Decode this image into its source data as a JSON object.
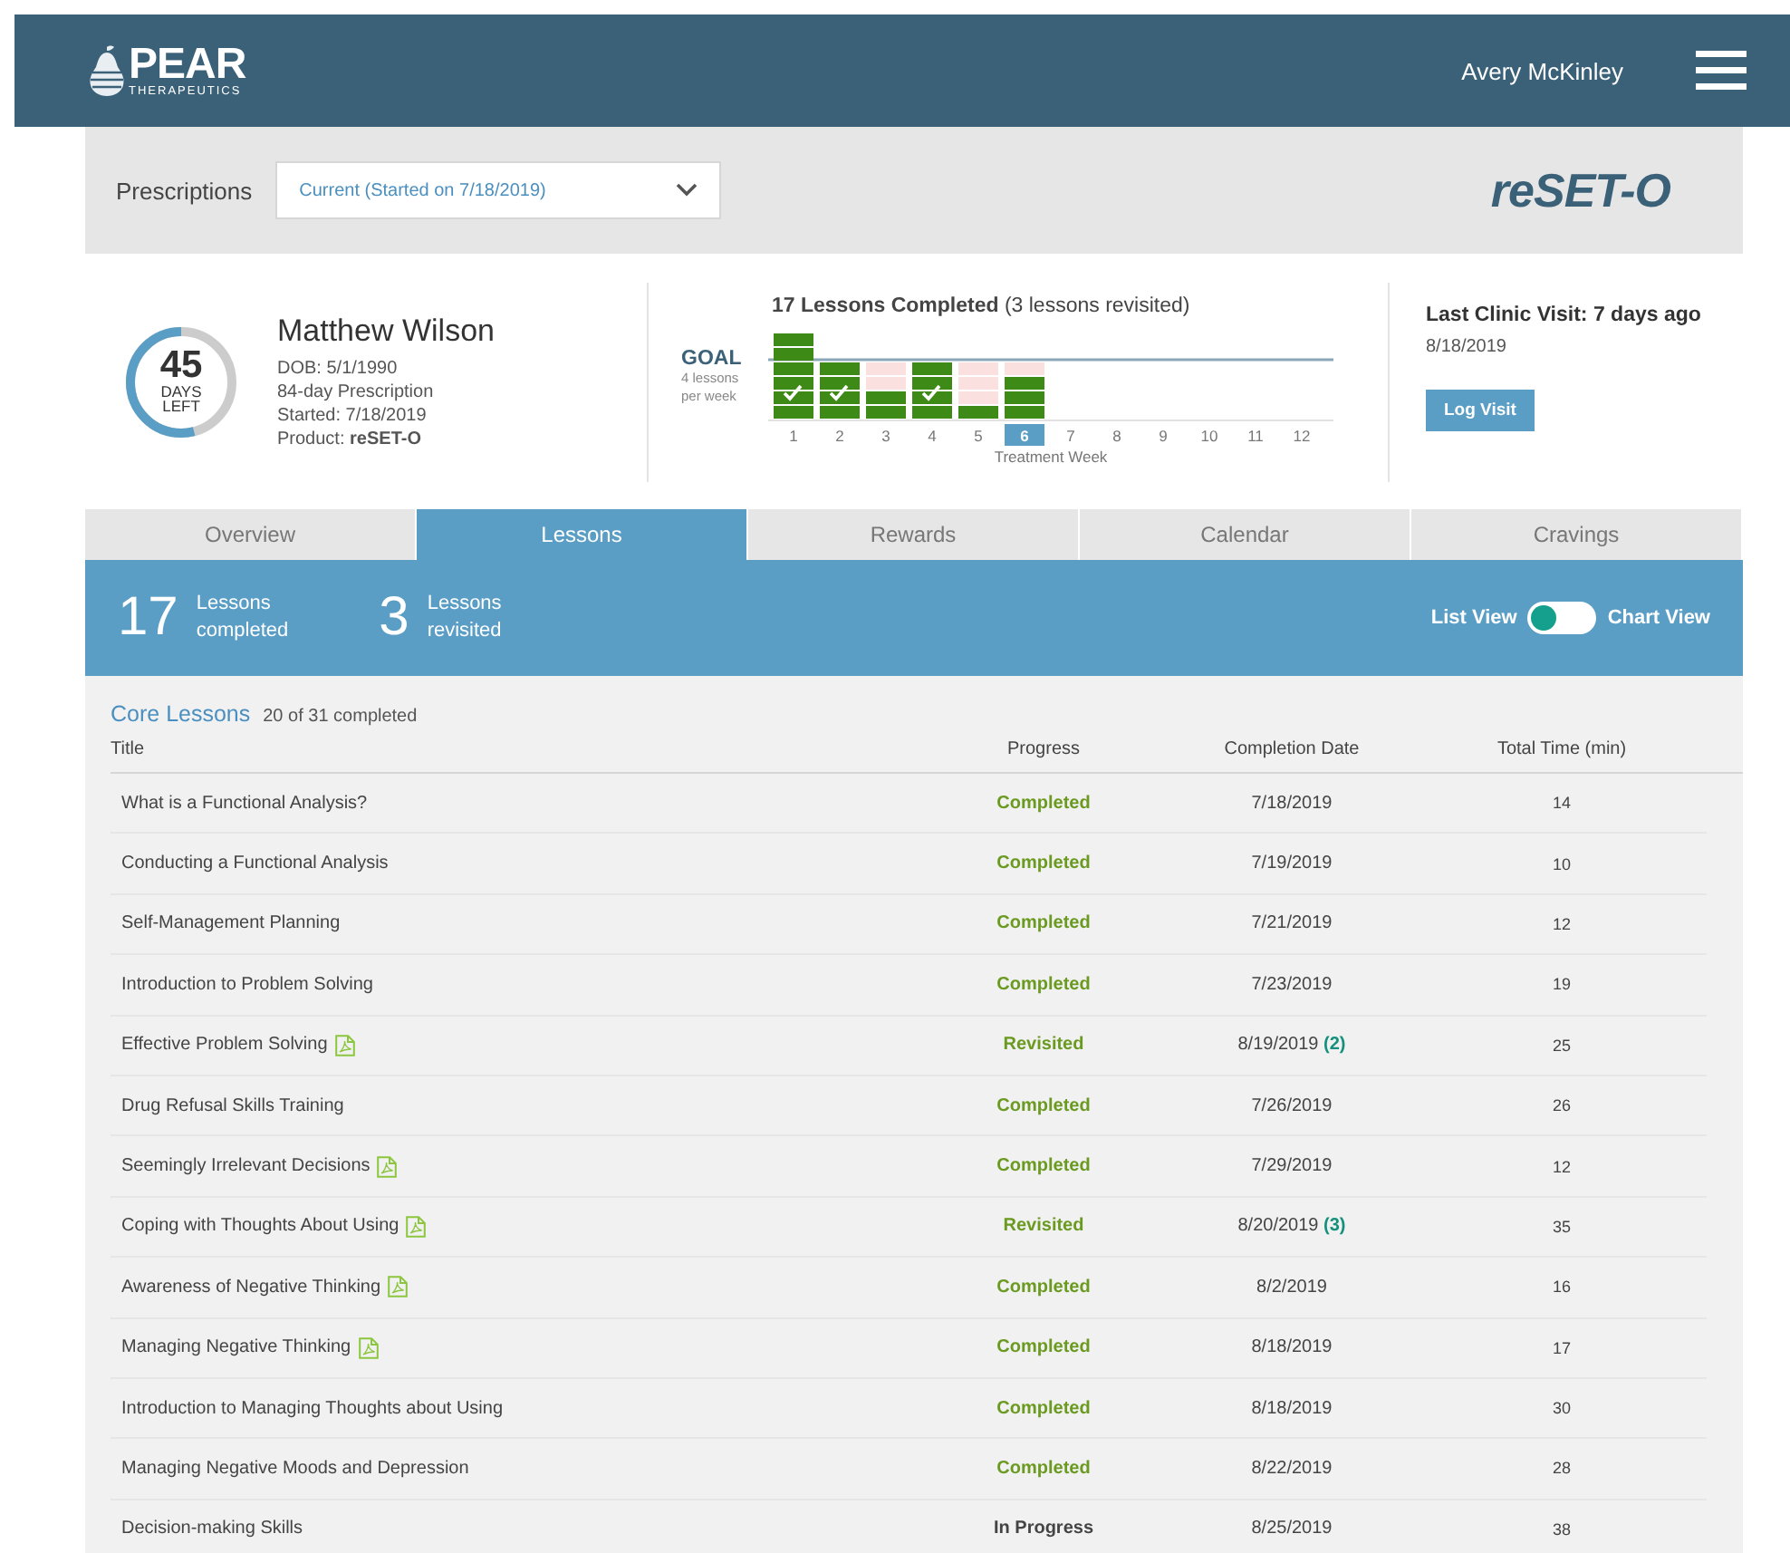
{
  "header": {
    "brand": "PEAR",
    "brand_sub": "THERAPEUTICS",
    "user": "Avery McKinley"
  },
  "prescriptions": {
    "label": "Prescriptions",
    "value": "Current (Started on 7/18/2019)",
    "product_logo": "reSET-O"
  },
  "patient": {
    "days_left": "45",
    "days_caption": "DAYS",
    "left_caption": "LEFT",
    "level": 0.54,
    "name": "Matthew Wilson",
    "details": [
      "DOB: 5/1/1990",
      "84-day Prescription",
      "Started: 7/18/2019",
      "Product: **reSET-O**"
    ]
  },
  "progress": {
    "title": "**17 Lessons Completed**  (3 lessons revisited)",
    "goal_label": "GOAL",
    "goal_note": [
      "4 lessons",
      "per week"
    ],
    "weeks": [
      {
        "label": "1",
        "selected": false
      },
      {
        "label": "2",
        "selected": false
      },
      {
        "label": "3",
        "selected": false
      },
      {
        "label": "4",
        "selected": false
      },
      {
        "label": "5",
        "selected": false
      },
      {
        "label": "6",
        "selected": true
      },
      {
        "label": "7",
        "selected": false
      },
      {
        "label": "8",
        "selected": false
      },
      {
        "label": "9",
        "selected": false
      },
      {
        "label": "10",
        "selected": false
      },
      {
        "label": "11",
        "selected": false
      },
      {
        "label": "12",
        "selected": false
      }
    ],
    "xlabel": "Treatment Week"
  },
  "clinic": {
    "title": "Last Clinic Visit: 7 days ago",
    "date": "8/18/2019",
    "button": "Log Visit"
  },
  "tabs": [
    {
      "label": "Overview",
      "selected": false
    },
    {
      "label": "Lessons",
      "selected": true
    },
    {
      "label": "Rewards",
      "selected": false
    },
    {
      "label": "Calendar",
      "selected": false
    },
    {
      "label": "Cravings",
      "selected": false
    }
  ],
  "summary": {
    "stats": [
      {
        "number": "17",
        "label": [
          "Lessons",
          "completed"
        ]
      },
      {
        "number": "3",
        "label": [
          "Lessons",
          "revisited"
        ]
      }
    ],
    "toggle": {
      "left_label": "List View",
      "right_label": "Chart View",
      "on": false
    }
  },
  "core_lessons": {
    "title": "Core Lessons",
    "count": "20 of 31 completed",
    "columns": [
      "Title",
      "Progress",
      "Completion Date",
      "Total Time (min)"
    ],
    "rows": [
      {
        "title": "What is a Functional Analysis?",
        "pdf": false,
        "progress": "Completed",
        "kind": "completed",
        "date": "7/18/2019",
        "time": "14"
      },
      {
        "title": "Conducting a Functional Analysis",
        "pdf": false,
        "progress": "Completed",
        "kind": "completed",
        "date": "7/19/2019",
        "time": "10"
      },
      {
        "title": "Self-Management Planning",
        "pdf": false,
        "progress": "Completed",
        "kind": "completed",
        "date": "7/21/2019",
        "time": "12"
      },
      {
        "title": "Introduction to Problem Solving",
        "pdf": false,
        "progress": "Completed",
        "kind": "completed",
        "date": "7/23/2019",
        "time": "19"
      },
      {
        "title": "Effective Problem Solving",
        "pdf": true,
        "progress": "Revisited",
        "kind": "revisited",
        "date": "8/19/2019",
        "revisits": "(2)",
        "time": "25"
      },
      {
        "title": "Drug Refusal Skills Training",
        "pdf": false,
        "progress": "Completed",
        "kind": "completed",
        "date": "7/26/2019",
        "time": "26"
      },
      {
        "title": "Seemingly Irrelevant Decisions",
        "pdf": true,
        "progress": "Completed",
        "kind": "completed",
        "date": "7/29/2019",
        "time": "12"
      },
      {
        "title": "Coping with Thoughts About Using",
        "pdf": true,
        "progress": "Revisited",
        "kind": "revisited",
        "date": "8/20/2019",
        "revisits": "(3)",
        "time": "35"
      },
      {
        "title": "Awareness of Negative Thinking",
        "pdf": true,
        "progress": "Completed",
        "kind": "completed",
        "date": "8/2/2019",
        "time": "16"
      },
      {
        "title": "Managing Negative Thinking",
        "pdf": true,
        "progress": "Completed",
        "kind": "completed",
        "date": "8/18/2019",
        "time": "17"
      },
      {
        "title": "Introduction to Managing Thoughts about Using",
        "pdf": false,
        "progress": "Completed",
        "kind": "completed",
        "date": "8/18/2019",
        "time": "30"
      },
      {
        "title": "Managing Negative Moods and Depression",
        "pdf": false,
        "progress": "Completed",
        "kind": "completed",
        "date": "8/22/2019",
        "time": "28"
      },
      {
        "title": "Decision-making Skills",
        "pdf": false,
        "progress": "In Progress",
        "kind": "in_progress",
        "date": "8/25/2019",
        "time": "38"
      }
    ]
  }
}
